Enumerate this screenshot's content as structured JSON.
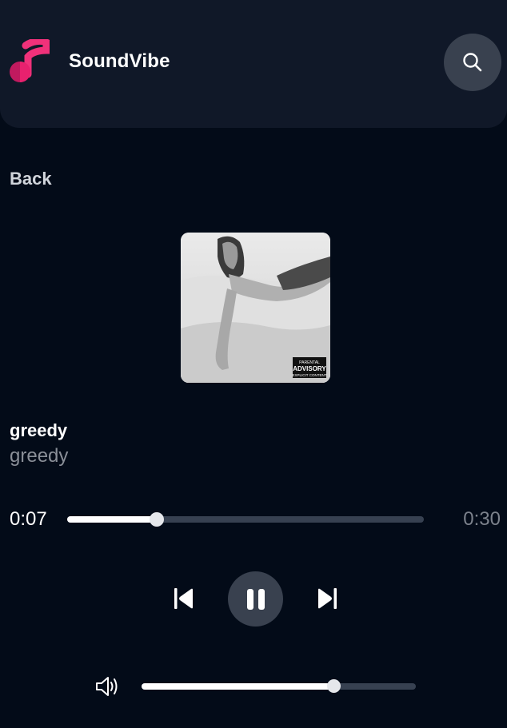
{
  "app": {
    "name": "SoundVibe",
    "logo_icon": "music-note-icon",
    "search_icon": "search-icon"
  },
  "nav": {
    "back_label": "Back"
  },
  "track": {
    "title": "greedy",
    "artist": "greedy",
    "album_art": "album-cover-image",
    "advisory_label": [
      "PARENTAL",
      "ADVISORY",
      "EXPLICIT CONTENT"
    ]
  },
  "playback": {
    "current_time": "0:07",
    "total_time": "0:30",
    "progress_fraction": 0.25,
    "is_playing": true,
    "prev_icon": "skip-previous-icon",
    "pause_icon": "pause-icon",
    "next_icon": "skip-next-icon"
  },
  "volume": {
    "icon": "volume-icon",
    "level_fraction": 0.7
  },
  "colors": {
    "background": "#030b18",
    "header": "#101828",
    "control_bg": "#39414f",
    "track_bg": "#374151",
    "logo_pink": "#e11d74",
    "logo_magenta": "#be185d",
    "muted_text": "#8a8f98"
  }
}
